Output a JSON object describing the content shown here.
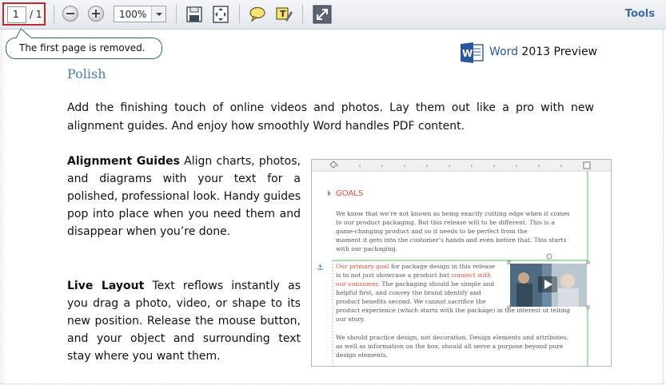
{
  "toolbar": {
    "page_number": "1",
    "page_total": "/ 1",
    "zoom_value": "100%",
    "tools_label": "Tools"
  },
  "callout": {
    "text": "The first page is removed."
  },
  "document": {
    "word_brand": "Word",
    "word_title_rest": " 2013 Preview",
    "heading": "Polish",
    "intro": "Add the finishing touch of online videos and photos. Lay them out like a pro with new alignment guides. And enjoy how smoothly Word handles PDF content.",
    "alignment_title": "Alignment Guides",
    "alignment_body": " Align charts, photos, and diagrams with your text for a polished, professional look. Handy guides pop into place when you need them and disappear when you’re done.",
    "live_title": "Live Layout",
    "live_body": "  Text reflows instantly as you drag a photo, video, or shape to its new position. Release the mouse button, and your object and surrounding text stay where you want them."
  },
  "thumbnail": {
    "goals": "GOALS",
    "p1": [
      "We know that we’re not known as being exactly cutting edge when it comes",
      "to our product packaging. But this release will to be different. This is a",
      "game-changing product and so it needs to be perfect from the",
      "moment it gets into the customer’s hands and even before that. This starts",
      "with our packaging."
    ],
    "p2_highlight1": "Our primary goal",
    "p2_line1_rest": " for package design in this release",
    "p2_line2a": "is to not just showcase a product but ",
    "p2_highlight2a": "connect with",
    "p2_highlight2b": "our consumer",
    "p2_line3_rest": ". The packaging should be simple and",
    "p2_rest": [
      "helpful first, and convey the brand identify and",
      "product benefits second. We cannot sacrifice the",
      "product experience (which starts with the package) in the interest of telling",
      "our story."
    ],
    "p3": [
      "We should practice design, not decoration. Design elements and attributes,",
      "as well as information on the box, should all serve a purpose beyond pure",
      "design elements."
    ]
  },
  "colors": {
    "accent_red": "#c0282d",
    "heading_blue": "#4a7ab7",
    "tools_blue": "#3f6a9e",
    "word_blue": "#2b579a",
    "goals_red": "#e04a3a",
    "guide_green": "#6fcf6a"
  },
  "icons": [
    "minus-icon",
    "plus-icon",
    "save-icon",
    "fit-page-icon",
    "comment-icon",
    "highlight-icon",
    "fullscreen-icon",
    "word-logo-icon",
    "anchor-icon",
    "video-play-icon"
  ]
}
